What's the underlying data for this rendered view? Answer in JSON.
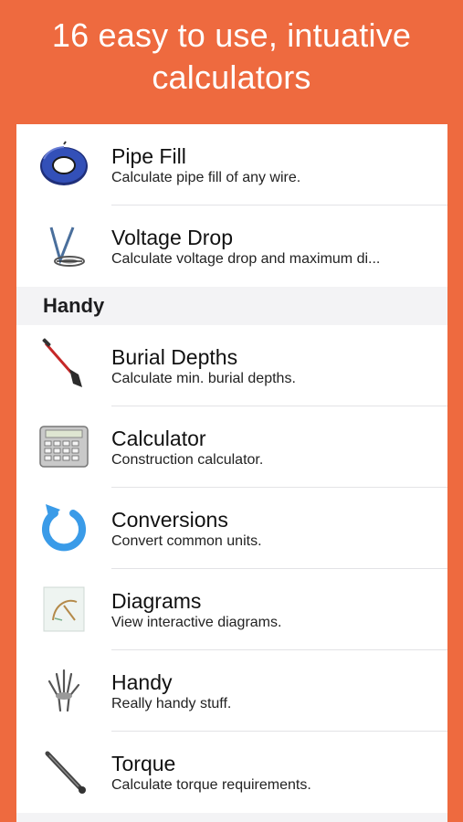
{
  "banner": {
    "line1": "16 easy to use, intuative",
    "line2": "calculators"
  },
  "list": {
    "top_items": [
      {
        "title": "Pipe Fill",
        "subtitle": "Calculate pipe fill of any wire.",
        "icon": "wire-spool-icon"
      },
      {
        "title": "Voltage Drop",
        "subtitle": "Calculate voltage drop and maximum di...",
        "icon": "voltage-drop-icon"
      }
    ],
    "section_header": "Handy",
    "handy_items": [
      {
        "title": "Burial Depths",
        "subtitle": "Calculate min. burial depths.",
        "icon": "shovel-icon"
      },
      {
        "title": "Calculator",
        "subtitle": "Construction calculator.",
        "icon": "calculator-icon"
      },
      {
        "title": "Conversions",
        "subtitle": "Convert common units.",
        "icon": "refresh-arrow-icon"
      },
      {
        "title": "Diagrams",
        "subtitle": "View interactive diagrams.",
        "icon": "diagram-icon"
      },
      {
        "title": "Handy",
        "subtitle": "Really handy stuff.",
        "icon": "hand-xray-icon"
      },
      {
        "title": "Torque",
        "subtitle": "Calculate torque requirements.",
        "icon": "torque-wrench-icon"
      }
    ]
  },
  "colors": {
    "background": "#ee6a3f",
    "panel": "#ffffff",
    "section": "#f3f3f5",
    "refresh_blue": "#3a9be8"
  }
}
